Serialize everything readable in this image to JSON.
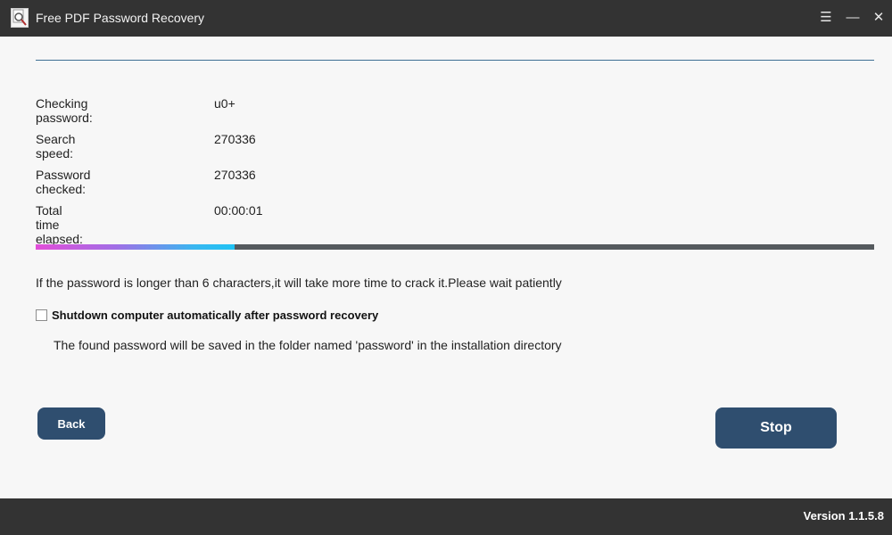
{
  "window": {
    "title": "Free PDF Password Recovery",
    "menu_glyph": "☰",
    "minimize_glyph": "—",
    "close_glyph": "✕"
  },
  "stats": [
    {
      "label": "Checking password:",
      "value": "u0+"
    },
    {
      "label": "Search speed:",
      "value": "270336"
    },
    {
      "label": "Password checked:",
      "value": "270336"
    },
    {
      "label": "Total time elapsed:",
      "value": "00:00:01"
    }
  ],
  "progress": {
    "fraction": 0.237,
    "colors": {
      "track": "#555a5e",
      "start": "#e24ed8",
      "end": "#1fc3f4"
    }
  },
  "notice": "If the password is longer than 6 characters,it will take more time to crack it.Please wait patiently",
  "shutdown_option": {
    "label": "Shutdown computer automatically after password recovery",
    "checked": false
  },
  "saved_note": "The found password will be saved in the folder named 'password' in the installation directory",
  "buttons": {
    "back": "Back",
    "stop": "Stop"
  },
  "footer": {
    "version": "Version 1.1.5.8"
  },
  "icons": {
    "app": "magnifier-document-icon",
    "menu": "hamburger-menu-icon",
    "minimize": "minimize-icon",
    "close": "close-icon"
  },
  "colors": {
    "titlebar": "#333333",
    "accent_rule": "#3e6f94",
    "button": "#2f4e6f"
  }
}
